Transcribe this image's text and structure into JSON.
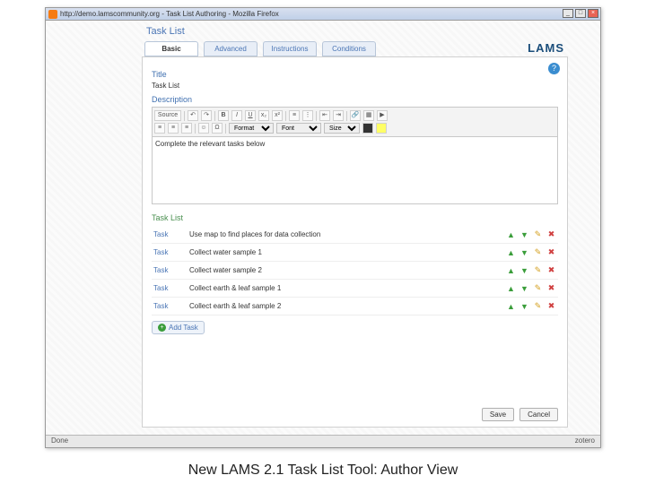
{
  "caption": "New LAMS 2.1 Task List Tool: Author View",
  "window": {
    "title": "http://demo.lamscommunity.org - Task List Authoring - Mozilla Firefox",
    "status_left": "Done",
    "status_right": "zotero"
  },
  "page": {
    "title": "Task List",
    "logo": "LAMS"
  },
  "tabs": [
    "Basic",
    "Advanced",
    "Instructions",
    "Conditions"
  ],
  "title_section": {
    "label": "Title",
    "value": "Task List"
  },
  "description_section": {
    "label": "Description",
    "body": "Complete the relevant tasks below",
    "font_label": "Font",
    "size_label": "Size",
    "format_label": "Format",
    "source_label": "Source"
  },
  "task_list": {
    "label": "Task List",
    "col_label": "Task",
    "tasks": [
      "Use map to find places for data collection",
      "Collect water sample 1",
      "Collect water sample 2",
      "Collect earth & leaf sample 1",
      "Collect earth & leaf sample 2"
    ],
    "add_label": "Add Task"
  },
  "buttons": {
    "save": "Save",
    "cancel": "Cancel"
  }
}
